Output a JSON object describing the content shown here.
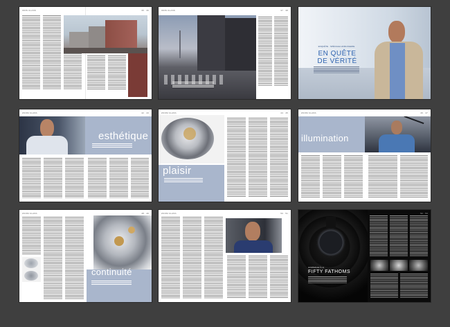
{
  "spreads": [
    {
      "header_left": "ORIS CLASS",
      "header_right": "35 · 36"
    },
    {
      "header_left": "ORIS CLASS",
      "header_right": "37 · 38"
    },
    {
      "kicker": "ENQUÊTE · SPÉCIALE HORLOGERIE",
      "title_line1": "EN QUÊTE",
      "title_line2": "DE VÉRITÉ"
    },
    {
      "header_left": "ZOOM CLASS",
      "header_right": "42 · 43",
      "big_word": "esthétique"
    },
    {
      "header_left": "ZOOM CLASS",
      "header_right": "44 · 45",
      "big_word": "plaisir"
    },
    {
      "header_left": "ZOOM CLASS",
      "header_right": "46 · 47",
      "big_word": "illumination"
    },
    {
      "header_left": "ZOOM CLASS",
      "header_right": "48 · 49",
      "big_word": "continuité"
    },
    {
      "header_left": "ZOOM CLASS",
      "header_right": "50 · 51"
    },
    {
      "header_left": "ZOOM CLASS",
      "header_right": "52 · 53",
      "kicker": "HOMMAGE À LA",
      "title": "FIFTY FATHOMS"
    }
  ]
}
